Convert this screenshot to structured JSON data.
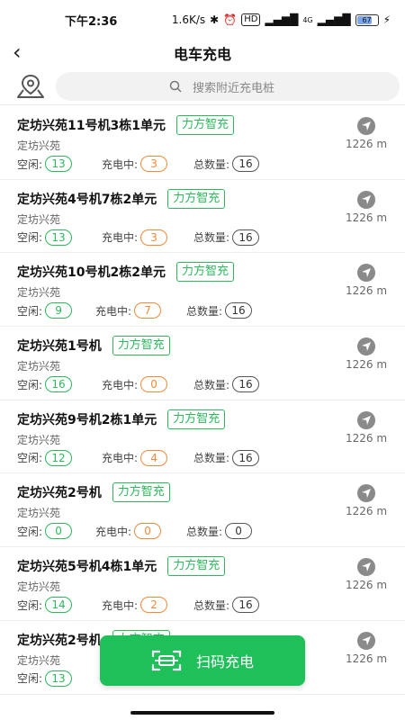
{
  "status_bar": {
    "time": "下午2:36",
    "speed": "1.6K/s",
    "hd_label": "HD",
    "net_label": "4G",
    "battery": "67"
  },
  "header": {
    "back_icon": "chevron-left-icon",
    "title": "电车充电"
  },
  "search": {
    "map_icon": "map-pin-icon",
    "placeholder": "搜索附近充电桩"
  },
  "labels": {
    "idle": "空闲:",
    "charging": "充电中:",
    "total": "总数量:"
  },
  "colors": {
    "accent_green": "#2db85c",
    "charging_orange": "#f08a3c",
    "button_green": "#1fbf5a"
  },
  "stations": [
    {
      "name": "定坊兴苑11号机3栋1单元",
      "brand": "力方智充",
      "community": "定坊兴苑",
      "idle": "13",
      "charging": "3",
      "total": "16",
      "distance": "1226 m"
    },
    {
      "name": "定坊兴苑4号机7栋2单元",
      "brand": "力方智充",
      "community": "定坊兴苑",
      "idle": "13",
      "charging": "3",
      "total": "16",
      "distance": "1226 m"
    },
    {
      "name": "定坊兴苑10号机2栋2单元",
      "brand": "力方智充",
      "community": "定坊兴苑",
      "idle": "9",
      "charging": "7",
      "total": "16",
      "distance": "1226 m"
    },
    {
      "name": "定坊兴苑1号机",
      "brand": "力方智充",
      "community": "定坊兴苑",
      "idle": "16",
      "charging": "0",
      "total": "16",
      "distance": "1226 m"
    },
    {
      "name": "定坊兴苑9号机2栋1单元",
      "brand": "力方智充",
      "community": "定坊兴苑",
      "idle": "12",
      "charging": "4",
      "total": "16",
      "distance": "1226 m"
    },
    {
      "name": "定坊兴苑2号机",
      "brand": "力方智充",
      "community": "定坊兴苑",
      "idle": "0",
      "charging": "0",
      "total": "0",
      "distance": "1226 m"
    },
    {
      "name": "定坊兴苑5号机4栋1单元",
      "brand": "力方智充",
      "community": "定坊兴苑",
      "idle": "14",
      "charging": "2",
      "total": "16",
      "distance": "1226 m"
    },
    {
      "name": "定坊兴苑2号机",
      "brand": "力方智充",
      "community": "定坊兴苑",
      "idle": "13",
      "charging": "",
      "total": "",
      "distance": "1226 m"
    }
  ],
  "scan_button": {
    "icon": "scan-icon",
    "label": "扫码充电"
  }
}
